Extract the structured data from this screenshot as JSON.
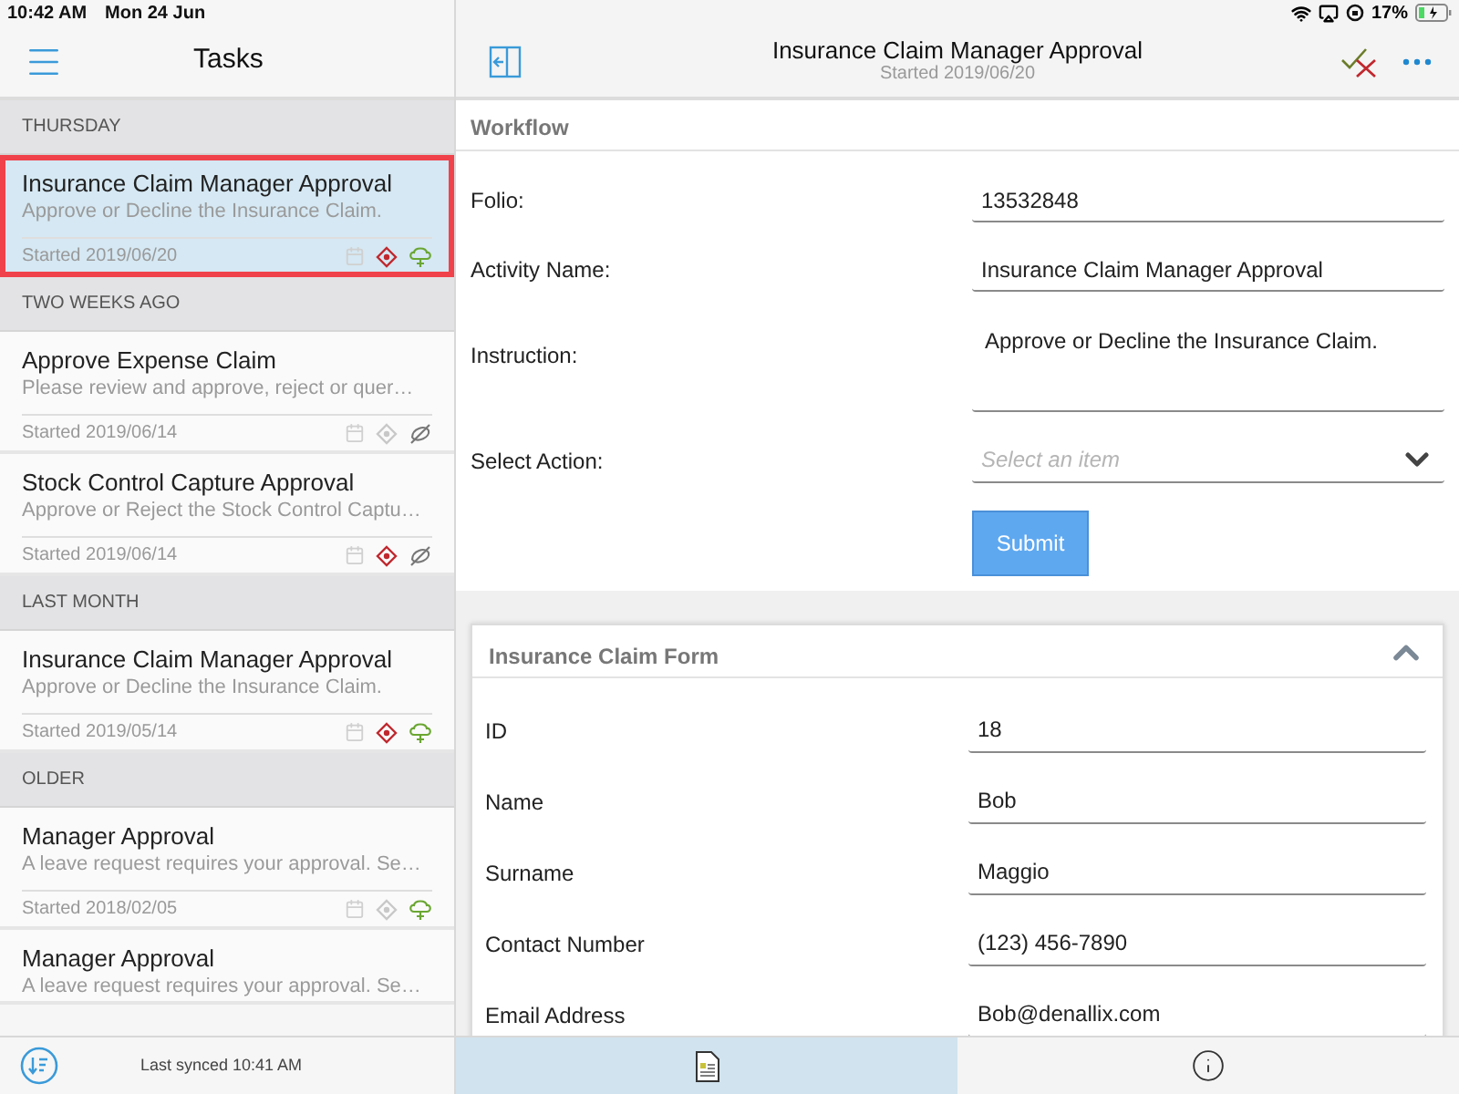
{
  "status_bar": {
    "time": "10:42 AM",
    "date": "Mon 24 Jun",
    "battery": "17%"
  },
  "sidebar": {
    "title": "Tasks",
    "groups": [
      {
        "heading": "THURSDAY",
        "tasks": [
          {
            "title": "Insurance Claim Manager Approval",
            "summary": "Approve or Decline the Insurance Claim.",
            "started": "Started 2019/06/20",
            "selected": true,
            "flagged": true,
            "shared": true
          }
        ]
      },
      {
        "heading": "TWO WEEKS AGO",
        "tasks": [
          {
            "title": "Approve Expense Claim",
            "summary": "Please review and approve, reject or quer…",
            "started": "Started 2019/06/14",
            "selected": false,
            "flagged": false,
            "shared": false
          },
          {
            "title": "Stock Control Capture Approval",
            "summary": "Approve or Reject the Stock Control Captu…",
            "started": "Started 2019/06/14",
            "selected": false,
            "flagged": true,
            "shared": false
          }
        ]
      },
      {
        "heading": "LAST MONTH",
        "tasks": [
          {
            "title": "Insurance Claim Manager Approval",
            "summary": "Approve or Decline the Insurance Claim.",
            "started": "Started 2019/05/14",
            "selected": false,
            "flagged": true,
            "shared": true
          }
        ]
      },
      {
        "heading": "OLDER",
        "tasks": [
          {
            "title": "Manager Approval",
            "summary": "A leave request requires your approval. Se…",
            "started": "Started 2018/02/05",
            "selected": false,
            "flagged": false,
            "shared": true
          },
          {
            "title": "Manager Approval",
            "summary": "A leave request requires your approval. Se…",
            "selected": false
          }
        ]
      }
    ],
    "footer": "Last synced 10:41 AM"
  },
  "detail": {
    "title": "Insurance Claim Manager Approval",
    "subtitle": "Started 2019/06/20",
    "workflow": {
      "heading": "Workflow",
      "fields": [
        {
          "kind": "text",
          "label": "Folio:",
          "value": "13532848"
        },
        {
          "kind": "text",
          "label": "Activity Name:",
          "value": "Insurance Claim Manager Approval"
        },
        {
          "kind": "multiline",
          "label": "Instruction:",
          "value": "Approve or Decline the Insurance Claim."
        },
        {
          "kind": "select",
          "label": "Select Action:",
          "placeholder": "Select an item"
        }
      ],
      "submit": "Submit"
    },
    "form": {
      "heading": "Insurance Claim Form",
      "expanded": true,
      "fields": [
        {
          "label": "ID",
          "value": "18"
        },
        {
          "label": "Name",
          "value": "Bob"
        },
        {
          "label": "Surname",
          "value": "Maggio"
        },
        {
          "label": "Contact Number",
          "value": "(123) 456-7890"
        },
        {
          "label": "Email Address",
          "value": "Bob@denallix.com"
        }
      ]
    },
    "tabs": [
      {
        "kind": "document",
        "selected": true
      },
      {
        "kind": "info",
        "selected": false
      }
    ]
  }
}
